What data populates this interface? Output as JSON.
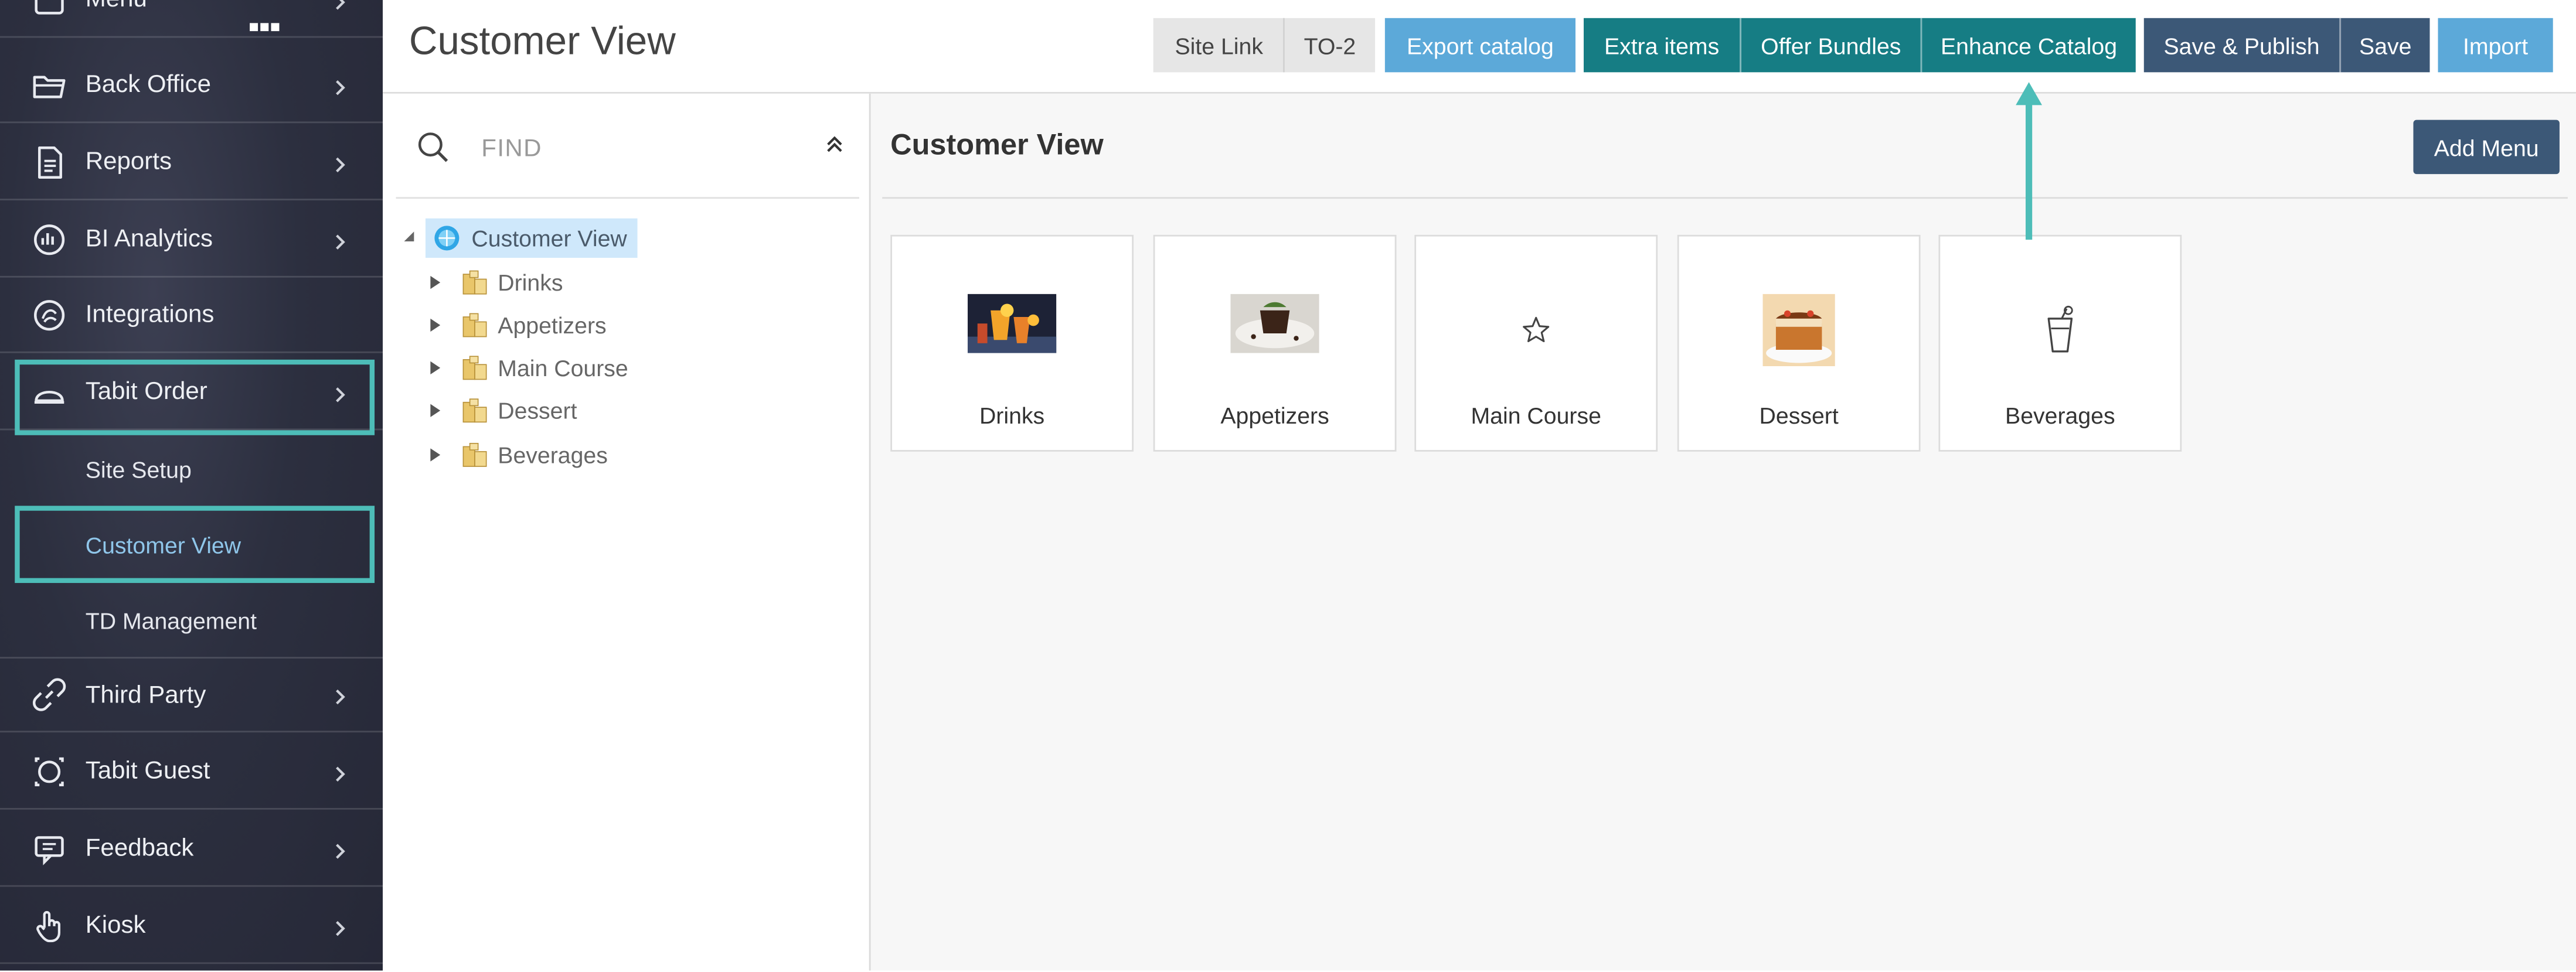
{
  "colors": {
    "teal_highlight": "#4dbdb8",
    "teal_button": "#167d84",
    "navy_button": "#3c5877",
    "light_blue_button": "#5ca9d9",
    "tree_selected": "#cfe8fb"
  },
  "sidebar": {
    "items": [
      {
        "label": "Menu",
        "icon": "menu-icon"
      },
      {
        "label": "Back Office",
        "icon": "folder-icon"
      },
      {
        "label": "Reports",
        "icon": "report-icon"
      },
      {
        "label": "BI Analytics",
        "icon": "analytics-icon"
      },
      {
        "label": "Integrations",
        "icon": "integrations-icon"
      },
      {
        "label": "Tabit Order",
        "icon": "cloche-icon"
      },
      {
        "label": "Third Party",
        "icon": "link-icon"
      },
      {
        "label": "Tabit Guest",
        "icon": "guest-icon"
      },
      {
        "label": "Feedback",
        "icon": "feedback-icon"
      },
      {
        "label": "Kiosk",
        "icon": "touch-icon"
      }
    ],
    "subitems": [
      {
        "label": "Site Setup"
      },
      {
        "label": "Customer View"
      },
      {
        "label": "TD Management"
      }
    ]
  },
  "header": {
    "title": "Customer View",
    "buttons": {
      "site_link": "Site Link",
      "to2": "TO-2",
      "export_catalog": "Export catalog",
      "extra_items": "Extra items",
      "offer_bundles": "Offer Bundles",
      "enhance_catalog": "Enhance Catalog",
      "save_publish": "Save & Publish",
      "save": "Save",
      "import": "Import"
    }
  },
  "tree": {
    "find_placeholder": "FIND",
    "root": "Customer View",
    "nodes": [
      "Drinks",
      "Appetizers",
      "Main Course",
      "Dessert",
      "Beverages"
    ]
  },
  "main": {
    "title": "Customer View",
    "add_menu": "Add Menu",
    "cards": [
      {
        "label": "Drinks",
        "thumb": "drinks-photo"
      },
      {
        "label": "Appetizers",
        "thumb": "appetizers-photo"
      },
      {
        "label": "Main Course",
        "thumb": "star-icon"
      },
      {
        "label": "Dessert",
        "thumb": "dessert-photo"
      },
      {
        "label": "Beverages",
        "thumb": "cup-icon"
      }
    ]
  }
}
